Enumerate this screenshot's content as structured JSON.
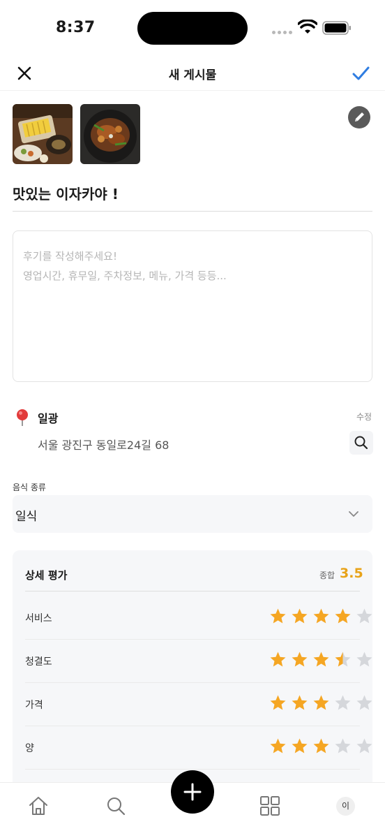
{
  "status_bar": {
    "time": "8:37"
  },
  "header": {
    "title": "새 게시물",
    "close_icon": "close-icon",
    "confirm_icon": "check-icon",
    "accent_color": "#2f7de1"
  },
  "photos": [
    {
      "description_icon": "food-photo-1"
    },
    {
      "description_icon": "food-photo-2"
    }
  ],
  "post": {
    "title": "맛있는 이자카야 !",
    "review_placeholder_line1": "후기를 작성해주세요!",
    "review_placeholder_line2": "영업시간, 휴무일, 주차정보, 메뉴, 가격 등등..."
  },
  "location": {
    "name": "일광",
    "edit_label": "수정",
    "address": "서울 광진구 동일로24길 68"
  },
  "food_type": {
    "label": "음식 종류",
    "selected": "일식"
  },
  "rating": {
    "title": "상세 평가",
    "overall_label": "종합",
    "overall_value": "3.5",
    "star_color": "#f5a623",
    "items": [
      {
        "label": "서비스",
        "score": 4
      },
      {
        "label": "청결도",
        "score": 3.5
      },
      {
        "label": "가격",
        "score": 3
      },
      {
        "label": "양",
        "score": 3
      }
    ]
  },
  "tab_bar": {
    "profile_initial": "이",
    "icons": [
      "home-icon",
      "search-icon",
      "plus-icon",
      "grid-icon",
      "profile-avatar"
    ]
  }
}
